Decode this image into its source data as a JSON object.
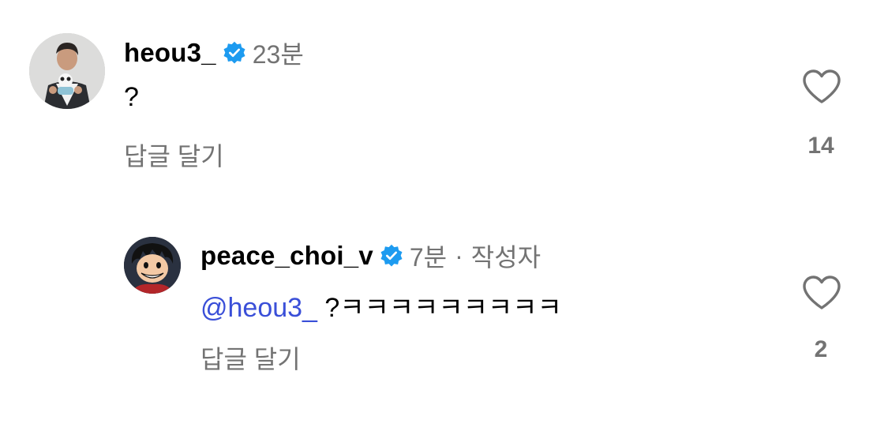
{
  "comments": [
    {
      "username": "heou3_",
      "verified": true,
      "time": "23분",
      "text": "?",
      "reply_label": "답글 달기",
      "like_count": "14",
      "avatar": "person-holding-plush-avatar"
    },
    {
      "username": "peace_choi_v",
      "verified": true,
      "time": "7분",
      "separator": "·",
      "author_badge": "작성자",
      "mention": "@heou3_",
      "text": " ?ㅋㅋㅋㅋㅋㅋㅋㅋㅋ",
      "reply_label": "답글 달기",
      "like_count": "2",
      "avatar": "cartoon-character-avatar"
    }
  ],
  "colors": {
    "verified": "#1d9bf0",
    "mention": "#3a4fd8",
    "secondary_text": "#737373"
  },
  "icons": [
    "verified-badge-icon",
    "heart-icon"
  ]
}
